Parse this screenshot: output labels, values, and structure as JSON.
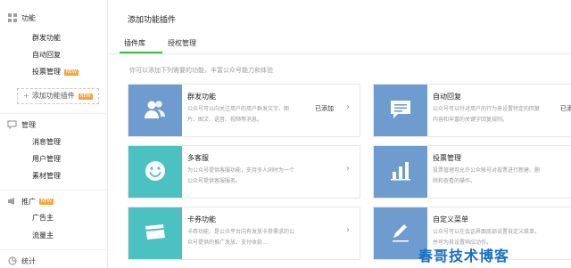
{
  "sidebar": {
    "sections": [
      {
        "title": "功能",
        "icon": "grid-icon",
        "items": [
          {
            "label": "群发功能"
          },
          {
            "label": "自动回复"
          },
          {
            "label": "投票管理",
            "badge": "NEW"
          }
        ]
      },
      {
        "title": "管理",
        "icon": "chat-bubble-icon",
        "items": [
          {
            "label": "消息管理"
          },
          {
            "label": "用户管理"
          },
          {
            "label": "素材管理"
          }
        ]
      },
      {
        "title": "推广",
        "icon": "megaphone-icon",
        "badge": "NEW",
        "items": [
          {
            "label": "广告主"
          },
          {
            "label": "流量主"
          }
        ]
      },
      {
        "title": "统计",
        "icon": "chart-icon",
        "items": []
      }
    ],
    "add_plugin": {
      "plus": "+",
      "label": "添加功能插件",
      "badge": "NEW"
    }
  },
  "main": {
    "title": "添加功能插件",
    "tabs": [
      {
        "label": "插件库",
        "active": true
      },
      {
        "label": "授权管理",
        "active": false
      }
    ],
    "description": "你可以添加下列需要的功能，丰富公众号能力和体验",
    "plugins": [
      {
        "title": "群发功能",
        "desc": "公众号可以向关注用户的用户群发文字、图片、图文、语音、视频等消息。",
        "status": "已添加",
        "icon": "users-icon",
        "color": "#6f9ccf"
      },
      {
        "title": "自动回复",
        "desc": "公众号可以针对用户的行为来设置特定的回复内容和丰富的关键字回复规则。",
        "status": "已添加",
        "icon": "message-icon",
        "color": "#6f9ccf"
      },
      {
        "title": "多客服",
        "desc": "为公众号提供客服功能，支持多人同时为一个公众号提供客服服务。",
        "status": "",
        "icon": "smile-icon",
        "color": "#4cc1c1"
      },
      {
        "title": "投票管理",
        "desc": "投票管理可允许公众帐号对投票进行新建、删除和查看的操作。",
        "status": "",
        "icon": "bar-chart-icon",
        "color": "#6f9ccf"
      },
      {
        "title": "卡券功能",
        "desc": "卡券功能，是公众平台向有发放卡券需求的公众号提供的推广发放、支付收款…",
        "status": "",
        "icon": "card-icon",
        "color": "#4cc1c1"
      },
      {
        "title": "自定义菜单",
        "desc": "公众号可以在会话界面底部设置自定义菜单，并可为其设置响应动作。",
        "status": "",
        "icon": "pencil-icon",
        "color": "#6f9ccf"
      }
    ]
  },
  "watermark": "春哥技术博客"
}
